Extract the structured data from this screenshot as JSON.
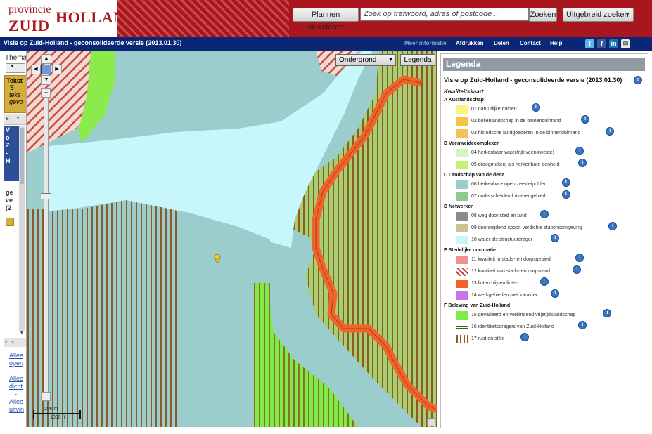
{
  "header": {
    "logo_line1": "provincie",
    "logo_holland": "HOLLAND",
    "logo_zuid": "ZUID",
    "plannen_btn": "Plannen selecteren",
    "search_placeholder": "Zoek op trefwoord, adres of postcode ...",
    "zoeken_btn": "Zoeken",
    "uitgebreid_btn": "Uitgebreid zoeken"
  },
  "navbar": {
    "title": "Visie op Zuid-Holland - geconsolideerde versie (2013.01.30)",
    "links": [
      "Meer informatie",
      "Afdrukken",
      "Delen",
      "Contact",
      "Help"
    ]
  },
  "leftpanel": {
    "tab_label": "Thema",
    "tekst_label": "Tekst",
    "tekst_line1": "'5",
    "tekst_line2": "teks",
    "tekst_line3": "gevo",
    "blue_v": "V",
    "blue_o": "o",
    "blue_z": "Z",
    "blue_h": "-",
    "blue_h2": "H",
    "g_text1": "ge",
    "g_text2": "ve",
    "g_text3": "(2",
    "links": [
      "Allee",
      "open",
      "-",
      "Allee",
      "dicht",
      "-",
      "Allee",
      "uitvin"
    ]
  },
  "map": {
    "ondergrond_label": "Ondergrond",
    "legenda_btn": "Legenda",
    "scale_m": "200 m",
    "scale_ft": "1000 ft"
  },
  "legend": {
    "header": "Legenda",
    "title": "Visie op Zuid-Holland - geconsolideerde versie (2013.01.30)",
    "subtitle": "Kwaliteitskaart",
    "sections": [
      {
        "label": "A Kustlandschap",
        "items": [
          {
            "label": "01 natuurlijke duinen",
            "color": "#fdf383"
          },
          {
            "label": "02 bollenlandschap in de binnenduinrand",
            "color": "#f5c242"
          },
          {
            "label": "03 historische landgoederen in de binnenduinrand",
            "color": "#f7bf5d"
          }
        ]
      },
      {
        "label": "B Veenweidecomplexen",
        "items": [
          {
            "label": "04 herkenbaar water(rijk veen)(weide)",
            "color": "#d3f5c3"
          },
          {
            "label": "05 droogmakerij als herkenbare eenheid",
            "color": "#c7f078"
          }
        ]
      },
      {
        "label": "C Landschap van de delta",
        "items": [
          {
            "label": "06 herkenbare open zeekleipolder",
            "color": "#9ccdcd"
          },
          {
            "label": "07 onderscheidend rivierengebied",
            "color": "#8fc98b"
          }
        ]
      },
      {
        "label": "D Netwerken",
        "items": [
          {
            "label": "08 weg door stad en land",
            "color": "#8c8c8c"
          },
          {
            "label": "09 doorsnijdend spoor, verdichte stationsomgeving",
            "color": "#c9c396"
          },
          {
            "label": "10 water als structuurdrager",
            "color": "#c7f6fb"
          }
        ]
      },
      {
        "label": "E Stedelijke occupatie",
        "items": [
          {
            "label": "11 kwaliteit in stads- en dorpsgebied",
            "color": "#f39191"
          },
          {
            "label": "12 kwaliteit van stads- en dorpsrand",
            "color": "hatch"
          },
          {
            "label": "13 linten blijven linten",
            "color": "#f0642c"
          },
          {
            "label": "14 werkgebieden met karakter",
            "color": "#c774e6"
          }
        ]
      },
      {
        "label": "F Beleving van Zuid-Holland",
        "items": [
          {
            "label": "15 gevarieerd en verbindend vrijetijdslandschap",
            "color": "#7fec45"
          },
          {
            "label": "16 identiteitsdragers van Zuid-Holland",
            "color": "line"
          },
          {
            "label": "17 rust en stilte",
            "color": "vstripe"
          }
        ]
      }
    ]
  }
}
